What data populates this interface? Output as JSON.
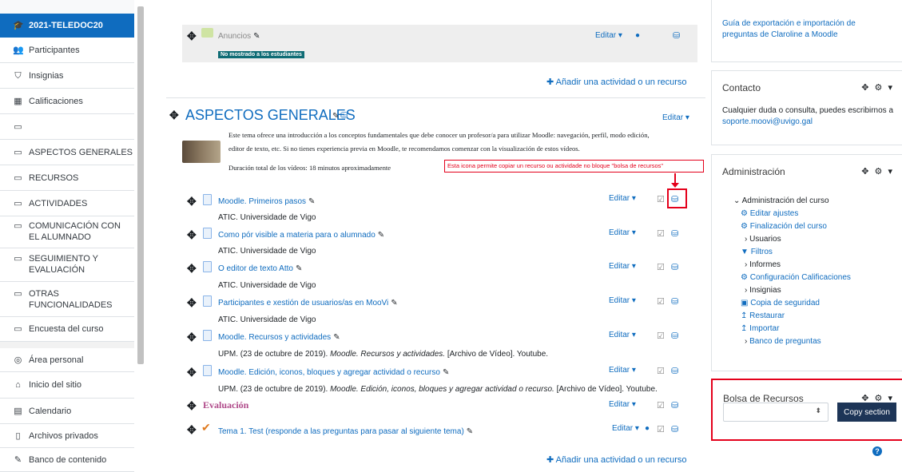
{
  "nav": {
    "course": "2021-TELEDOC20",
    "items": [
      "Participantes",
      "Insignias",
      "Calificaciones",
      "",
      "ASPECTOS GENERALES",
      "RECURSOS",
      "ACTIVIDADES",
      "COMUNICACIÓN CON\nEL ALUMNADO",
      "SEGUIMIENTO Y\nEVALUACIÓN",
      "OTRAS\nFUNCIONALIDADES",
      "Encuesta del curso"
    ],
    "global": [
      "Área personal",
      "Inicio del sitio",
      "Calendario",
      "Archivos privados",
      "Banco de contenido"
    ]
  },
  "main": {
    "announcements": "Anuncios",
    "hidden_badge": "No mostrado a los estudiantes",
    "edit_label": "Editar",
    "add_activity": "Añadir una actividad o un recurso",
    "section_title": "ASPECTOS GENERALES",
    "section_desc1": "Este tema ofrece una introducción a los conceptos fundamentales que debe conocer un profesor/a para utilizar Moodle:  navegación, perfil, modo edición,",
    "section_desc2": "editor de texto, etc. Si no tienes experiencia previa en Moodle, te recomendamos comenzar con la visualización de estos vídeos.",
    "duration": "Duración total de los vídeos: 18 minutos aproximadamente",
    "annotation": "Esta icona permite copiar un recurso ou actividade no bloque \"bolsa de recursos\"",
    "activities": [
      {
        "name": "Moodle. Primeiros pasos",
        "desc": "ATIC. Universidade de Vigo"
      },
      {
        "name": "Como pór visible a materia para o alumnado",
        "desc": "ATIC. Universidade de Vigo"
      },
      {
        "name": "O editor de texto Atto",
        "desc": "ATIC. Universidade de Vigo"
      },
      {
        "name": "Participantes e xestión de usuarios/as en MooVi",
        "desc": "ATIC. Universidade de Vigo"
      },
      {
        "name": "Moodle. Recursos y actividades",
        "desc_plain": "UPM. (23 de octubre de 2019). ",
        "desc_italic": "Moodle. Recursos y actividades.",
        "desc_tail": " [Archivo de Vídeo]. Youtube."
      },
      {
        "name": "Moodle. Edición, iconos, bloques y agregar actividad o recurso",
        "desc_plain": "UPM. (23 de octubre de 2019). ",
        "desc_italic": "Moodle. Edición, iconos, bloques y agregar actividad o recurso.",
        "desc_tail": " [Archivo de Vídeo]. Youtube."
      }
    ],
    "evaluation": "Evaluación",
    "quiz": "Tema 1. Test (responde a las preguntas para pasar al siguiente tema)"
  },
  "right": {
    "guide_link": "Guía de exportación e importación de preguntas de Claroline a Moodle",
    "contact_title": "Contacto",
    "contact_text": "Cualquier duda o consulta, puedes escribirnos a ",
    "contact_email": "soporte.moovi@uvigo.gal",
    "admin_title": "Administración",
    "admin_items": [
      "Administración del curso",
      "Editar ajustes",
      "Finalización del curso",
      "Usuarios",
      "Filtros",
      "Informes",
      "Configuración Calificaciones",
      "Insignias",
      "Copia de seguridad",
      "Restaurar",
      "Importar",
      "Banco de preguntas"
    ],
    "bag_title": "Bolsa de Recursos",
    "copy_section": "Copy section"
  },
  "colors": {
    "accent": "#0f6cbf",
    "annotation_red": "#e4001b",
    "copy_button": "#1d3557"
  }
}
